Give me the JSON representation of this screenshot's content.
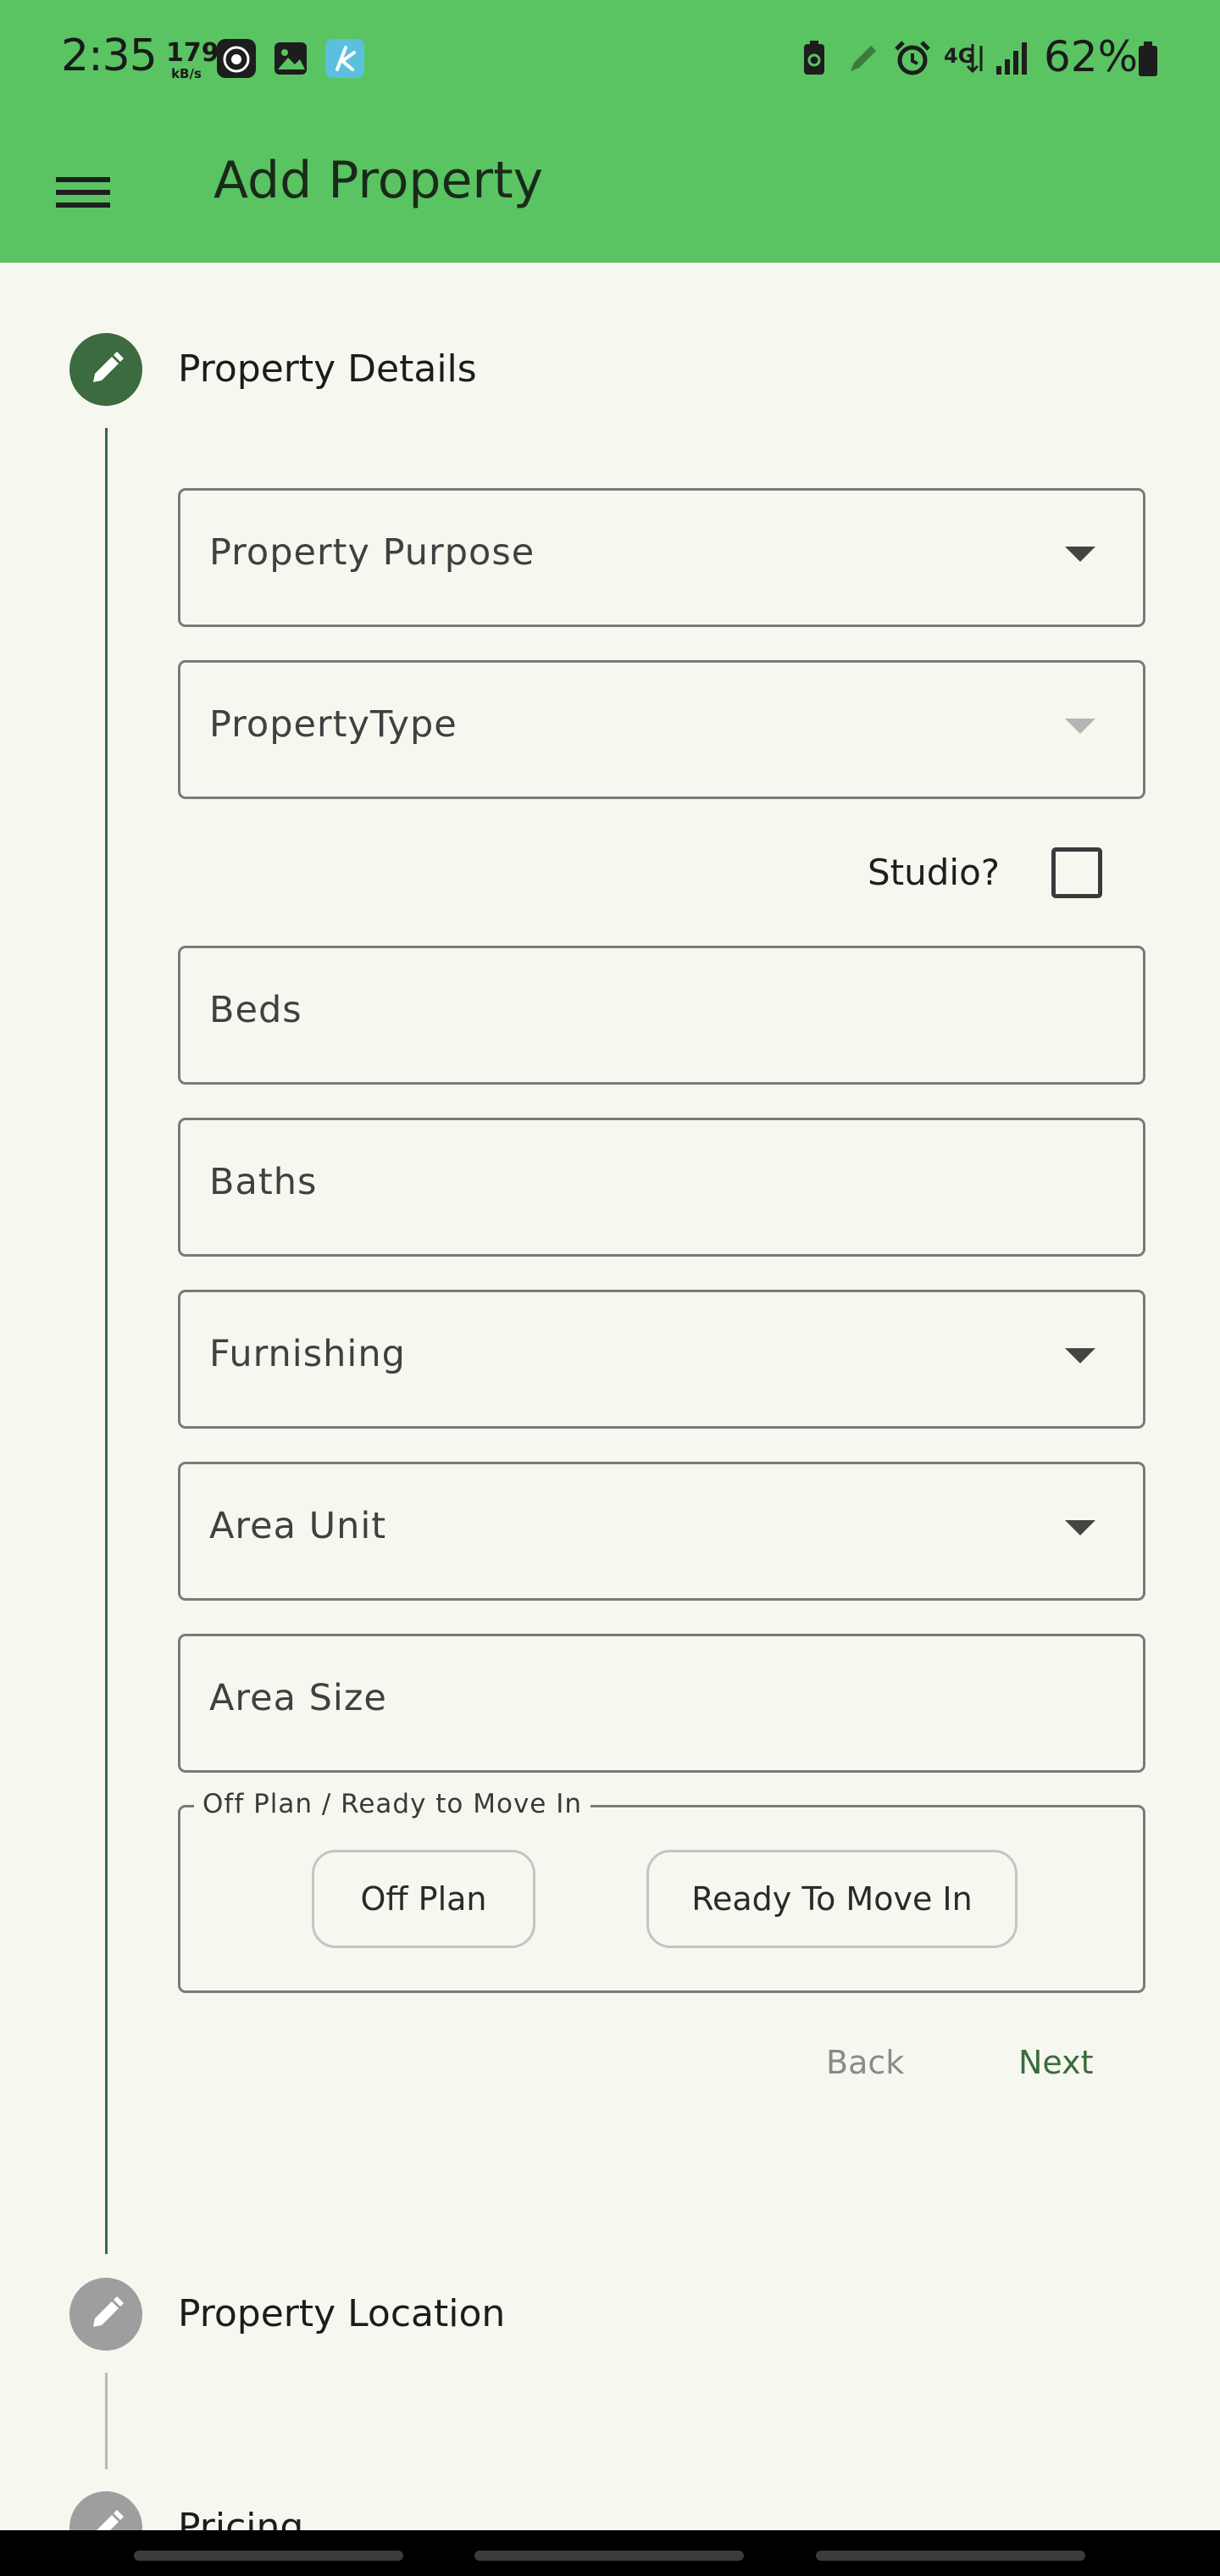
{
  "status_bar": {
    "time": "2:35",
    "net_speed": "179",
    "net_speed_unit": "kB/s",
    "battery_percent": "62%",
    "icons": [
      "reddit-style-app-icon",
      "gallery-icon",
      "kite-app-icon",
      "battery-saver-icon",
      "pencil-icon",
      "alarm-icon",
      "4g-signal-icon",
      "signal-bars-icon",
      "battery-icon"
    ]
  },
  "app_bar": {
    "menu_icon": "hamburger-menu-icon",
    "title": "Add Property"
  },
  "stepper": {
    "steps": [
      {
        "title": "Property Details",
        "icon": "pencil-icon",
        "state": "active"
      },
      {
        "title": "Property Location",
        "icon": "pencil-icon",
        "state": "inactive"
      },
      {
        "title": "Pricing",
        "icon": "pencil-icon",
        "state": "inactive"
      }
    ]
  },
  "form": {
    "property_purpose": {
      "label": "Property Purpose",
      "value": ""
    },
    "property_type": {
      "label": "PropertyType",
      "value": ""
    },
    "studio": {
      "label": "Studio?",
      "checked": false
    },
    "beds": {
      "label": "Beds",
      "value": ""
    },
    "baths": {
      "label": "Baths",
      "value": ""
    },
    "furnishing": {
      "label": "Furnishing",
      "value": ""
    },
    "area_unit": {
      "label": "Area Unit",
      "value": ""
    },
    "area_size": {
      "label": "Area Size",
      "value": ""
    },
    "completion": {
      "legend": "Off Plan / Ready to Move In",
      "options": [
        "Off Plan",
        "Ready To Move In"
      ]
    }
  },
  "actions": {
    "back_label": "Back",
    "next_label": "Next"
  },
  "colors": {
    "app_bar": "#5ac463",
    "background": "#f6f8f0",
    "active_step": "#3b6b3e",
    "inactive_step": "#9e9e9e",
    "next_text": "#3b6b3e"
  }
}
